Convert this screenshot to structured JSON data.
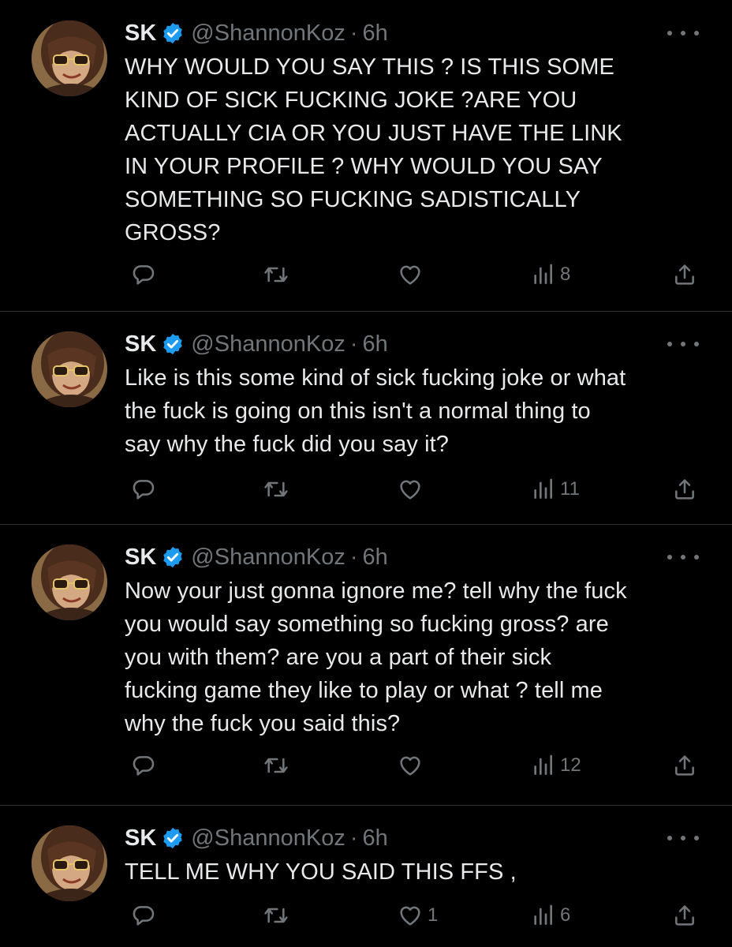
{
  "colors": {
    "background": "#000000",
    "text": "#e7e9ea",
    "muted": "#71767b",
    "verified": "#1d9bf0",
    "divider": "#2f3336"
  },
  "tweets": [
    {
      "name": "SK",
      "handle": "@ShannonKoz",
      "separator": "·",
      "time": "6h",
      "lines": [
        "WHY WOULD YOU SAY THIS ? IS THIS SOME",
        "KIND OF SICK FUCKING JOKE ?ARE YOU",
        "ACTUALLY CIA OR YOU JUST HAVE THE LINK",
        "IN YOUR PROFILE ? WHY WOULD YOU SAY",
        "SOMETHING SO FUCKING SADISTICALLY",
        "GROSS?"
      ],
      "reply_count": "",
      "retweet_count": "",
      "like_count": "",
      "view_count": "8",
      "icons": [
        "reply-icon",
        "retweet-icon",
        "like-icon",
        "views-icon",
        "share-icon"
      ]
    },
    {
      "name": "SK",
      "handle": "@ShannonKoz",
      "separator": "·",
      "time": "6h",
      "lines": [
        "Like is this some kind of sick fucking joke or what",
        "the fuck is going on this isn't a normal thing to",
        "say why the fuck did you say it?"
      ],
      "reply_count": "",
      "retweet_count": "",
      "like_count": "",
      "view_count": "11",
      "icons": [
        "reply-icon",
        "retweet-icon",
        "like-icon",
        "views-icon",
        "share-icon"
      ]
    },
    {
      "name": "SK",
      "handle": "@ShannonKoz",
      "separator": "·",
      "time": "6h",
      "lines": [
        "Now your just gonna ignore me? tell why the fuck",
        "you would say something so fucking gross? are",
        "you with them? are you a part of their sick",
        "fucking game they like to play or what ? tell me",
        "why the fuck you said this?"
      ],
      "reply_count": "",
      "retweet_count": "",
      "like_count": "",
      "view_count": "12",
      "icons": [
        "reply-icon",
        "retweet-icon",
        "like-icon",
        "views-icon",
        "share-icon"
      ]
    },
    {
      "name": "SK",
      "handle": "@ShannonKoz",
      "separator": "·",
      "time": "6h",
      "lines": [
        "TELL ME WHY YOU SAID THIS FFS ,"
      ],
      "reply_count": "",
      "retweet_count": "",
      "like_count": "1",
      "view_count": "6",
      "icons": [
        "reply-icon",
        "retweet-icon",
        "like-icon",
        "views-icon",
        "share-icon"
      ]
    }
  ]
}
